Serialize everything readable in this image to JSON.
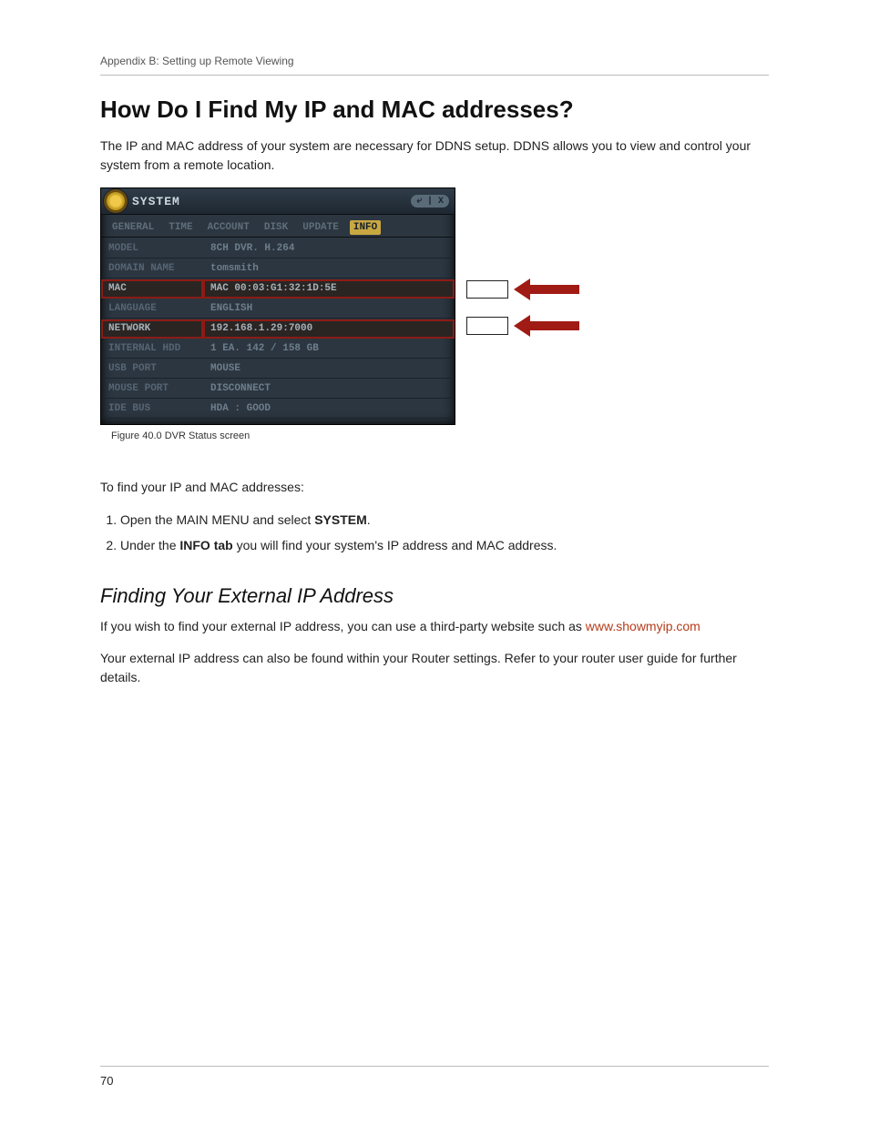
{
  "runningHead": "Appendix B: Setting up Remote Viewing",
  "heading1": "How Do I Find My IP and MAC addresses?",
  "intro": "The IP and MAC address of your system are necessary for DDNS setup. DDNS allows you to view and control your system from a remote location.",
  "dvr": {
    "window": {
      "title": "SYSTEM",
      "controls": "⤶ | X"
    },
    "tabs": [
      "GENERAL",
      "TIME",
      "ACCOUNT",
      "DISK",
      "UPDATE",
      "INFO"
    ],
    "activeTab": "INFO",
    "rows": [
      {
        "label": "MODEL",
        "value": "8CH DVR. H.264",
        "highlight": false
      },
      {
        "label": "DOMAIN NAME",
        "value": "tomsmith",
        "highlight": false
      },
      {
        "label": "MAC",
        "value": "MAC 00:03:G1:32:1D:5E",
        "highlight": true
      },
      {
        "label": "LANGUAGE",
        "value": "ENGLISH",
        "highlight": false
      },
      {
        "label": "NETWORK",
        "value": "192.168.1.29:7000",
        "highlight": true
      },
      {
        "label": "INTERNAL HDD",
        "value": "1 EA. 142 / 158 GB",
        "highlight": false
      },
      {
        "label": "USB PORT",
        "value": "MOUSE",
        "highlight": false
      },
      {
        "label": "MOUSE PORT",
        "value": "DISCONNECT",
        "highlight": false
      },
      {
        "label": "IDE BUS",
        "value": "HDA :    GOOD",
        "highlight": false
      }
    ]
  },
  "figureCaption": "Figure 40.0 DVR Status screen",
  "stepsIntro": "To find your IP and MAC addresses:",
  "steps": [
    {
      "pre": "Open the MAIN MENU and select ",
      "bold": "SYSTEM",
      "post": "."
    },
    {
      "pre": "Under the ",
      "bold": "INFO tab",
      "post": " you will find your system's IP address and MAC address."
    }
  ],
  "subheading": "Finding Your External IP Address",
  "ext1a": "If you wish to find your external IP address, you can use a third-party website such as ",
  "extLink": "www.showmyip.com",
  "ext2": "Your external IP address can also be found within your Router settings. Refer to your router user guide for further details.",
  "pageNumber": "70"
}
